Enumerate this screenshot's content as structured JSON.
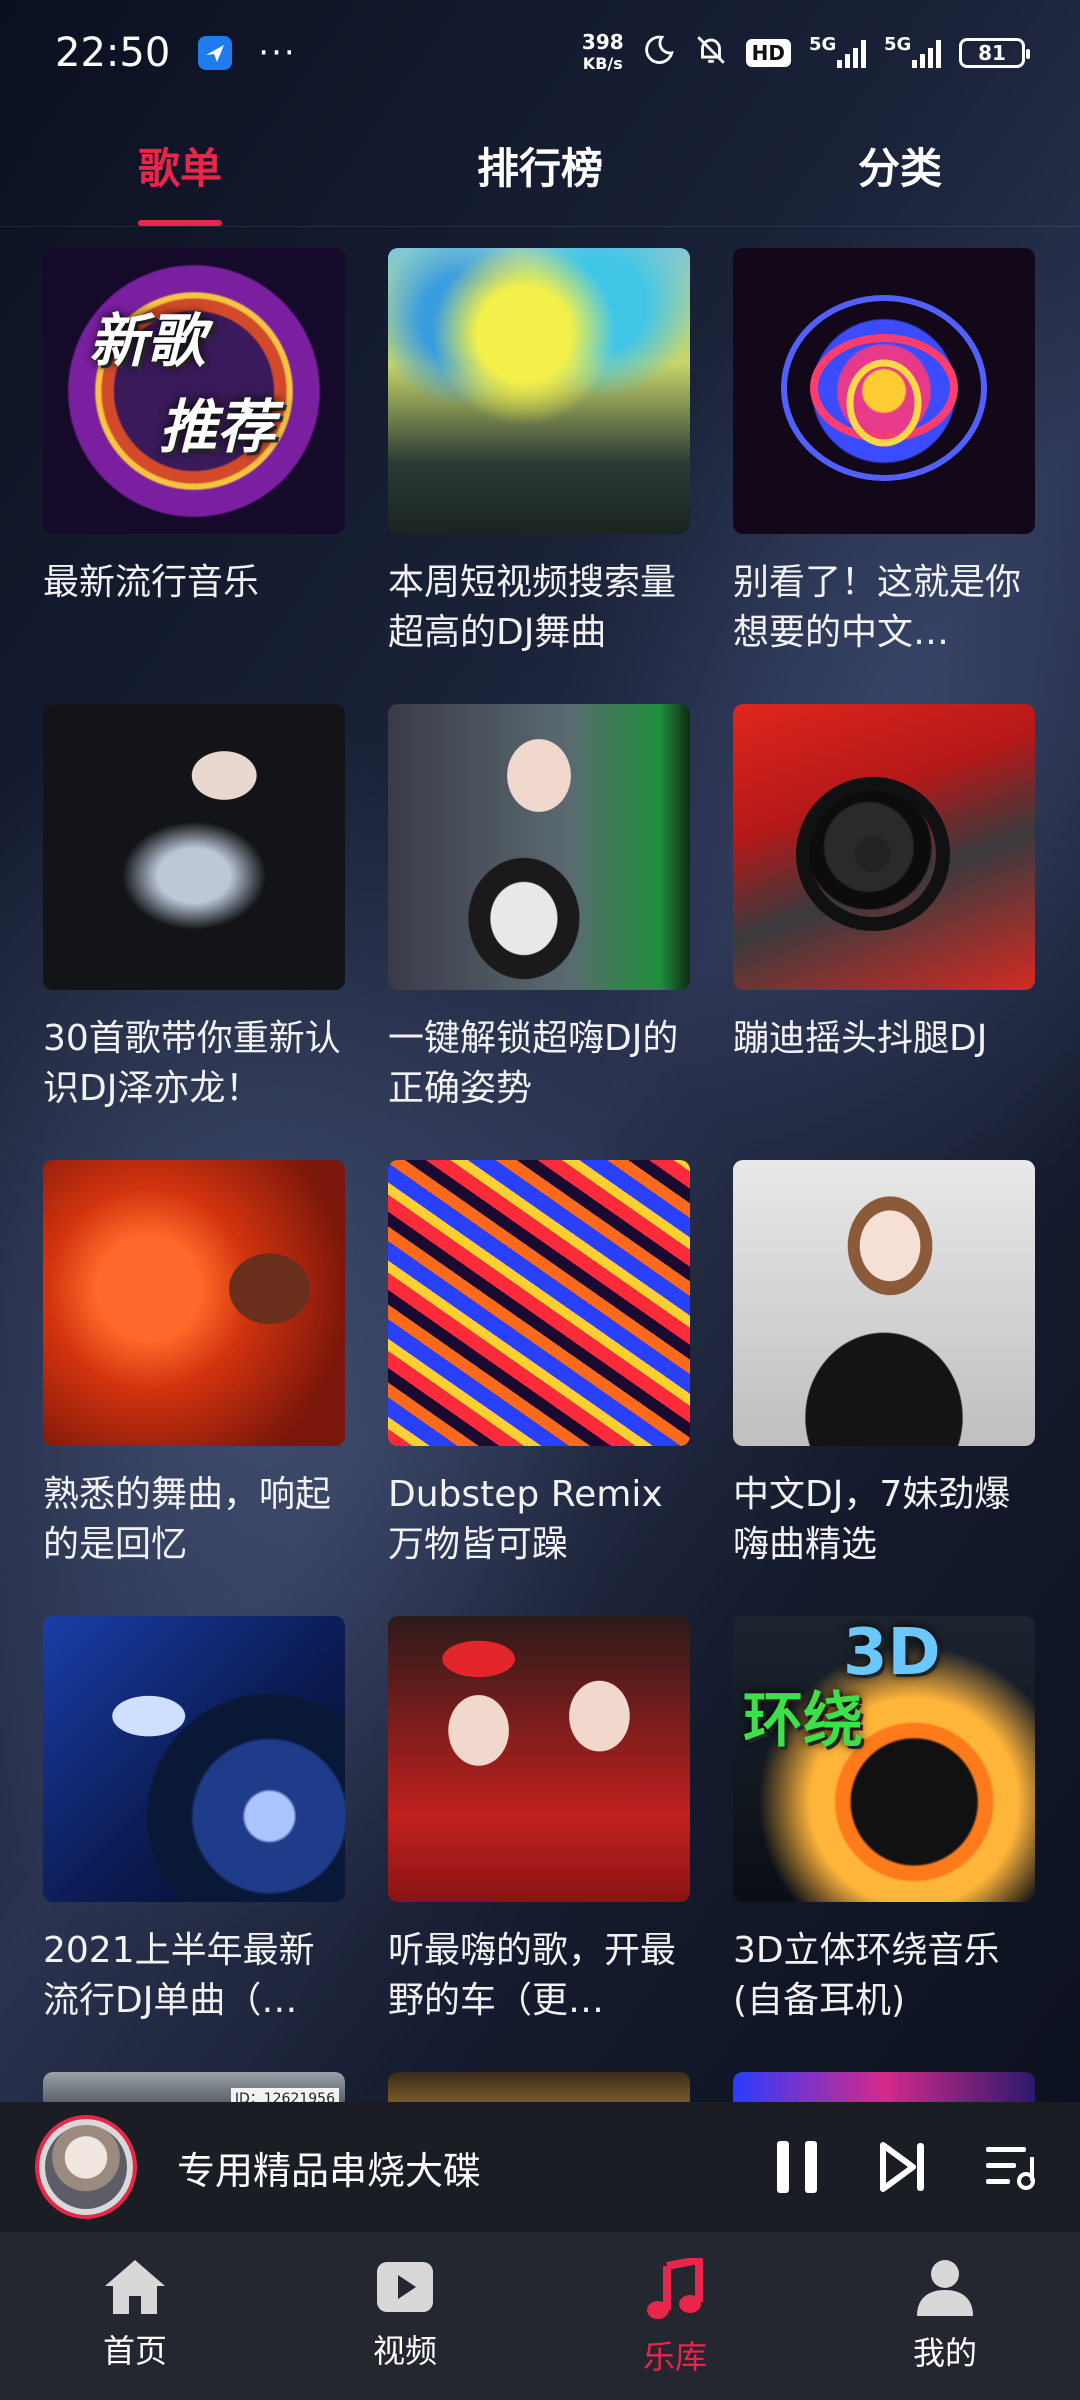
{
  "status_bar": {
    "time": "22:50",
    "more": "···",
    "net_speed_value": "398",
    "net_speed_unit": "KB/s",
    "hd_badge": "HD",
    "signal1_tag": "5G",
    "signal2_tag": "5G",
    "battery": "81"
  },
  "tabs": [
    {
      "label": "歌单",
      "active": true
    },
    {
      "label": "排行榜",
      "active": false
    },
    {
      "label": "分类",
      "active": false
    }
  ],
  "playlists": [
    {
      "title": "最新流行音乐",
      "cover_text": "新歌\n推荐"
    },
    {
      "title": "本周短视频搜索量超高的DJ舞曲"
    },
    {
      "title": "别看了！这就是你想要的中文…"
    },
    {
      "title": "30首歌带你重新认识DJ泽亦龙！"
    },
    {
      "title": "一键解锁超嗨DJ的正确姿势"
    },
    {
      "title": "蹦迪摇头抖腿DJ"
    },
    {
      "title": "熟悉的舞曲，响起的是回忆"
    },
    {
      "title": "Dubstep Remix 万物皆可躁"
    },
    {
      "title": "中文DJ，7妹劲爆嗨曲精选"
    },
    {
      "title": "2021上半年最新流行DJ单曲（…"
    },
    {
      "title": "听最嗨的歌，开最野的车（更…"
    },
    {
      "title": "3D立体环绕音乐(自备耳机)",
      "cover_text": "3D 环绕"
    }
  ],
  "partial_row": {
    "label_1": "ID：12621956"
  },
  "mini_player": {
    "now_playing": "专用精品串烧大碟"
  },
  "bottom_nav": [
    {
      "label": "首页",
      "icon": "home-icon",
      "active": false
    },
    {
      "label": "视频",
      "icon": "video-icon",
      "active": false
    },
    {
      "label": "乐库",
      "icon": "music-note-icon",
      "active": true
    },
    {
      "label": "我的",
      "icon": "person-icon",
      "active": false
    }
  ],
  "colors": {
    "accent": "#e8264b",
    "player_bg": "#1b1d24",
    "nav_bg": "#252730"
  }
}
